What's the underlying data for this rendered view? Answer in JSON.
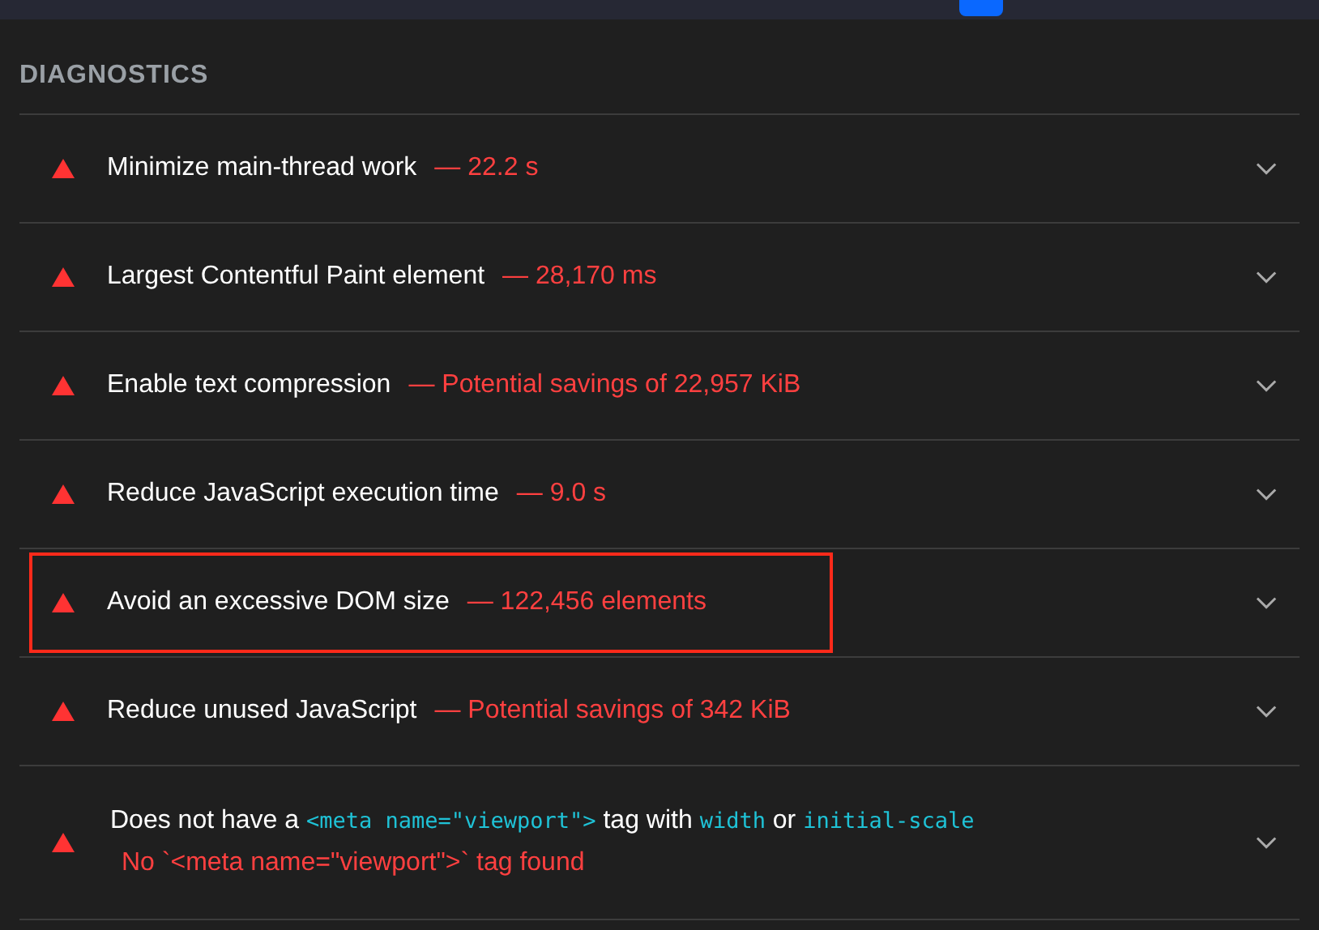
{
  "section": {
    "title": "DIAGNOSTICS"
  },
  "audits": [
    {
      "kind": "plain",
      "title": "Minimize main-thread work",
      "display_value": "— 22.2 s",
      "highlighted": false
    },
    {
      "kind": "plain",
      "title": "Largest Contentful Paint element",
      "display_value": "— 28,170 ms",
      "highlighted": false
    },
    {
      "kind": "plain",
      "title": "Enable text compression",
      "display_value": "— Potential savings of 22,957 KiB",
      "highlighted": false
    },
    {
      "kind": "plain",
      "title": "Reduce JavaScript execution time",
      "display_value": "— 9.0 s",
      "highlighted": false
    },
    {
      "kind": "plain",
      "title": "Avoid an excessive DOM size",
      "display_value": "— 122,456 elements",
      "highlighted": true
    },
    {
      "kind": "plain",
      "title": "Reduce unused JavaScript",
      "display_value": "— Potential savings of 342 KiB",
      "highlighted": false
    },
    {
      "kind": "rich",
      "title_parts": [
        {
          "kind": "text",
          "text": "Does not have a "
        },
        {
          "kind": "code",
          "text": "<meta name=\"viewport\">"
        },
        {
          "kind": "text",
          "text": " tag with "
        },
        {
          "kind": "code",
          "text": "width"
        },
        {
          "kind": "text",
          "text": " or "
        },
        {
          "kind": "code",
          "text": "initial-scale"
        }
      ],
      "explanation": "No `<meta name=\"viewport\">` tag found",
      "highlighted": false
    }
  ]
}
